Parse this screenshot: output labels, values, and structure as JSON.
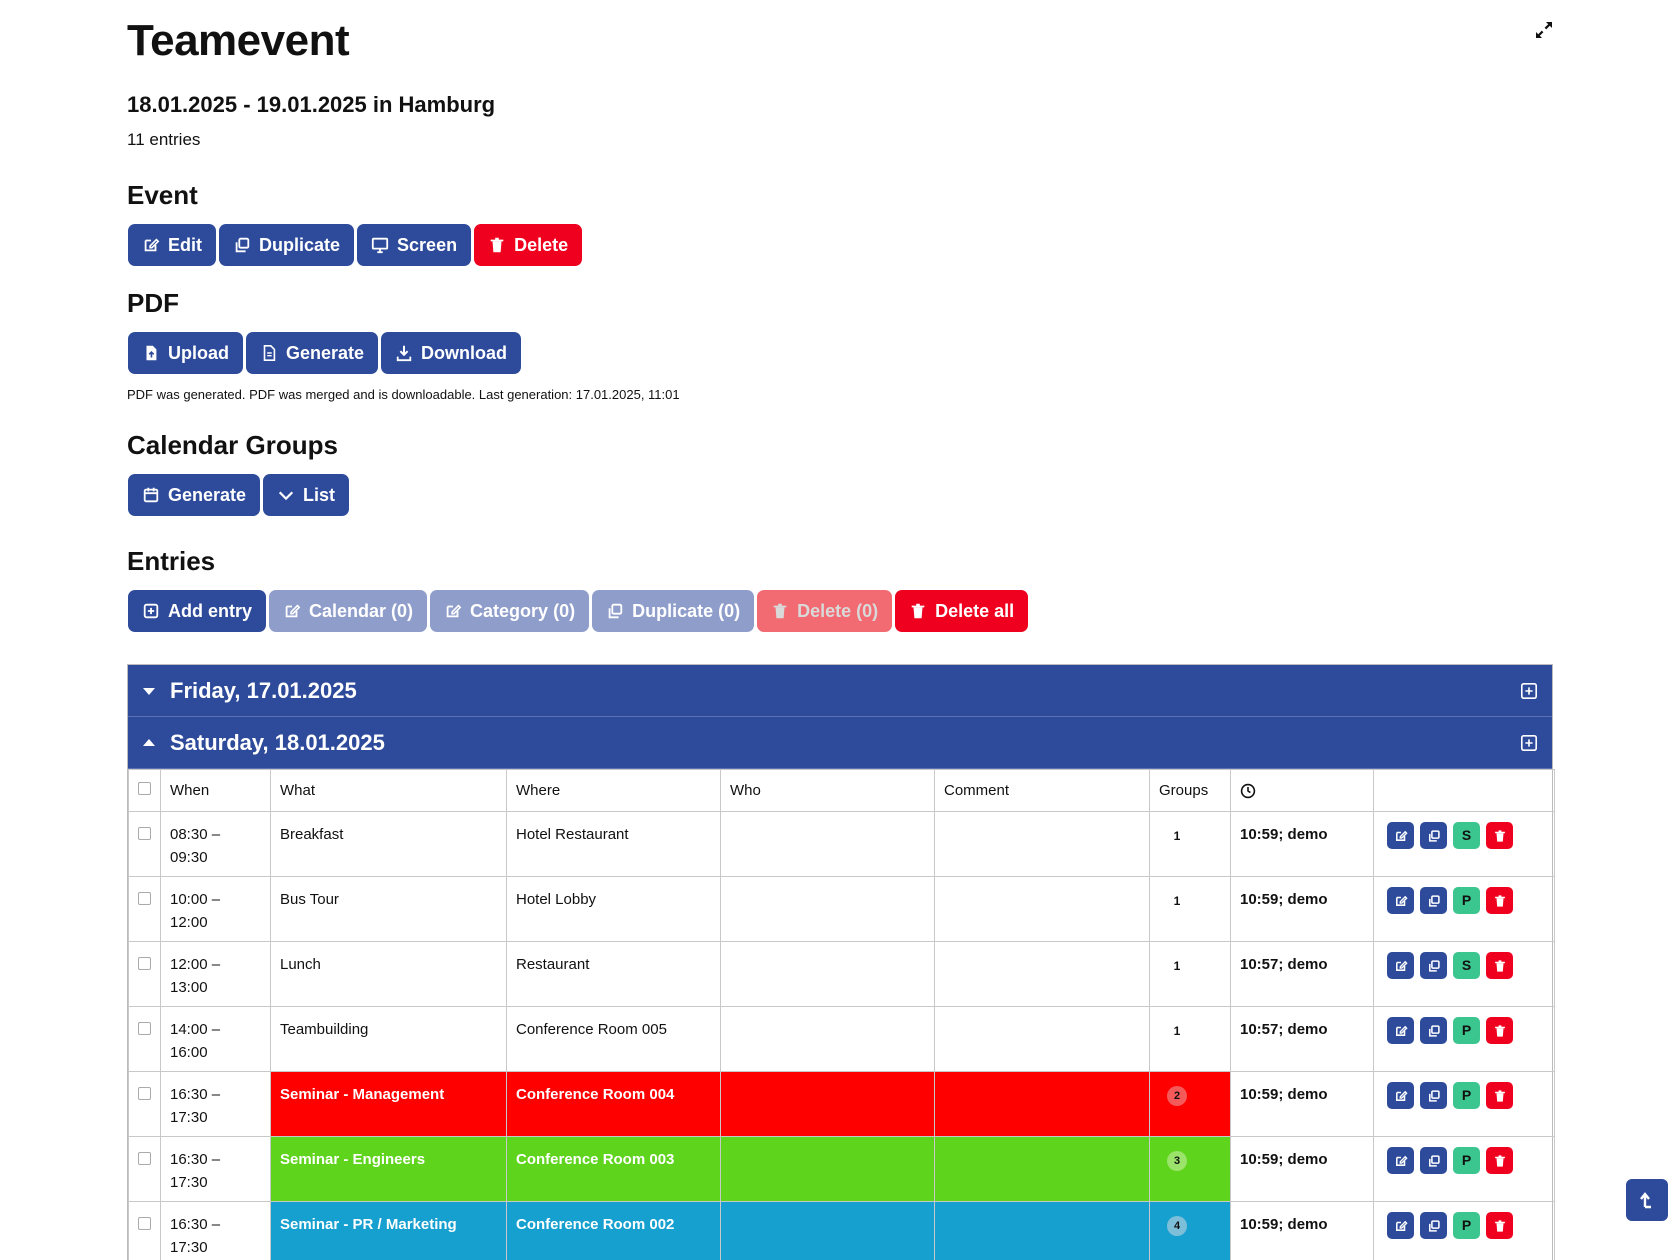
{
  "header": {
    "title": "Teamevent",
    "subtitle": "18.01.2025 - 19.01.2025 in Hamburg",
    "entry_count": "11 entries"
  },
  "event_section": {
    "heading": "Event",
    "buttons": {
      "edit": "Edit",
      "duplicate": "Duplicate",
      "screen": "Screen",
      "delete": "Delete"
    }
  },
  "pdf_section": {
    "heading": "PDF",
    "buttons": {
      "upload": "Upload",
      "generate": "Generate",
      "download": "Download"
    },
    "status": "PDF was generated. PDF was merged and is downloadable. Last generation: 17.01.2025, 11:01"
  },
  "calendar_groups": {
    "heading": "Calendar Groups",
    "buttons": {
      "generate": "Generate",
      "list": "List"
    }
  },
  "entries_section": {
    "heading": "Entries",
    "buttons": {
      "add_entry": "Add entry",
      "calendar": "Calendar (0)",
      "category": "Category (0)",
      "duplicate": "Duplicate (0)",
      "delete": "Delete (0)",
      "delete_all": "Delete all"
    }
  },
  "days": {
    "friday": {
      "label": "Friday, 17.01.2025",
      "expanded": false
    },
    "saturday": {
      "label": "Saturday, 18.01.2025",
      "expanded": true
    }
  },
  "table": {
    "columns": {
      "when": "When",
      "what": "What",
      "where": "Where",
      "who": "Who",
      "comment": "Comment",
      "groups": "Groups",
      "updated_icon": "clock-icon"
    },
    "rows": [
      {
        "when_start": "08:30 –",
        "when_end": "09:30",
        "what": "Breakfast",
        "where": "Hotel Restaurant",
        "who": "",
        "comment": "",
        "groups": "1",
        "updated": "10:59; demo",
        "toggle": "S",
        "color": ""
      },
      {
        "when_start": "10:00 –",
        "when_end": "12:00",
        "what": "Bus Tour",
        "where": "Hotel Lobby",
        "who": "",
        "comment": "",
        "groups": "1",
        "updated": "10:59; demo",
        "toggle": "P",
        "color": ""
      },
      {
        "when_start": "12:00 –",
        "when_end": "13:00",
        "what": "Lunch",
        "where": "Restaurant",
        "who": "",
        "comment": "",
        "groups": "1",
        "updated": "10:57; demo",
        "toggle": "S",
        "color": ""
      },
      {
        "when_start": "14:00 –",
        "when_end": "16:00",
        "what": "Teambuilding",
        "where": "Conference Room 005",
        "who": "",
        "comment": "",
        "groups": "1",
        "updated": "10:57; demo",
        "toggle": "P",
        "color": ""
      },
      {
        "when_start": "16:30 –",
        "when_end": "17:30",
        "what": "Seminar - Management",
        "where": "Conference Room 004",
        "who": "",
        "comment": "",
        "groups": "2",
        "updated": "10:59; demo",
        "toggle": "P",
        "color": "#ff0000",
        "badge_color": "#f45a5a"
      },
      {
        "when_start": "16:30 –",
        "when_end": "17:30",
        "what": "Seminar - Engineers",
        "where": "Conference Room 003",
        "who": "",
        "comment": "",
        "groups": "3",
        "updated": "10:59; demo",
        "toggle": "P",
        "color": "#5fd41c",
        "badge_color": "#9be36a"
      },
      {
        "when_start": "16:30 –",
        "when_end": "17:30",
        "what": "Seminar - PR / Marketing",
        "where": "Conference Room 002",
        "who": "",
        "comment": "",
        "groups": "4",
        "updated": "10:59; demo",
        "toggle": "P",
        "color": "#15a0cf",
        "badge_color": "#7dbfd9"
      }
    ]
  },
  "colors": {
    "primary": "#2e4b9b",
    "danger": "#f0001f",
    "muted": "#8f9dcb",
    "toggle_green": "#3cc68f"
  }
}
